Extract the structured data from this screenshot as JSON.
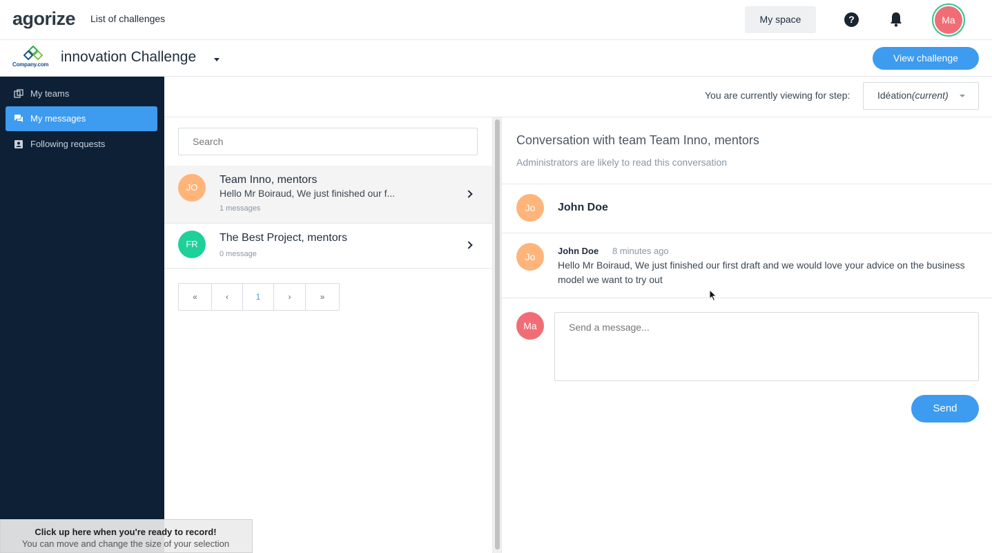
{
  "topbar": {
    "logo": "agorize",
    "nav_link": "List of challenges",
    "my_space": "My space",
    "help_icon": "?",
    "user_initials": "Ma"
  },
  "challenge": {
    "company_logo_text": "Company.com",
    "title": "innovation Challenge",
    "view_button": "View challenge"
  },
  "sidebar": {
    "items": [
      {
        "label": "My teams",
        "icon": "teams-icon",
        "active": false
      },
      {
        "label": "My messages",
        "icon": "messages-icon",
        "active": true
      },
      {
        "label": "Following requests",
        "icon": "requests-icon",
        "active": false
      }
    ]
  },
  "step": {
    "label": "You are currently viewing for step:",
    "value": "Idéation",
    "current": "(current)"
  },
  "conversations": {
    "search_placeholder": "Search",
    "items": [
      {
        "initials": "JO",
        "name": "Team Inno, mentors",
        "preview": "Hello Mr Boiraud, We just finished our f...",
        "count": "1 messages",
        "color": "#ffb47a"
      },
      {
        "initials": "FR",
        "name": "The Best Project, mentors",
        "preview": "",
        "count": "0 message",
        "color": "#1ed198"
      }
    ],
    "pager": {
      "first": "«",
      "prev": "‹",
      "page": "1",
      "next": "›",
      "last": "»"
    }
  },
  "panel": {
    "title": "Conversation with team Team Inno, mentors",
    "subtitle": "Administrators are likely to read this conversation",
    "member": {
      "initials": "Jo",
      "name": "John Doe",
      "color": "#ffb47a"
    },
    "message": {
      "initials": "Jo",
      "author": "John Doe",
      "time": "8 minutes ago",
      "body": "Hello Mr Boiraud, We just finished our first draft and we would love your advice on the business model we want to try out"
    },
    "composer": {
      "initials": "Ma",
      "placeholder": "Send a message...",
      "send": "Send",
      "color": "#f16d75"
    }
  },
  "recording": {
    "line1": "Click up here when you're ready to record!",
    "line2": "You can move and change the size of your selection"
  },
  "colors": {
    "accent": "#3d9bf0",
    "sidebar": "#0e2035"
  }
}
